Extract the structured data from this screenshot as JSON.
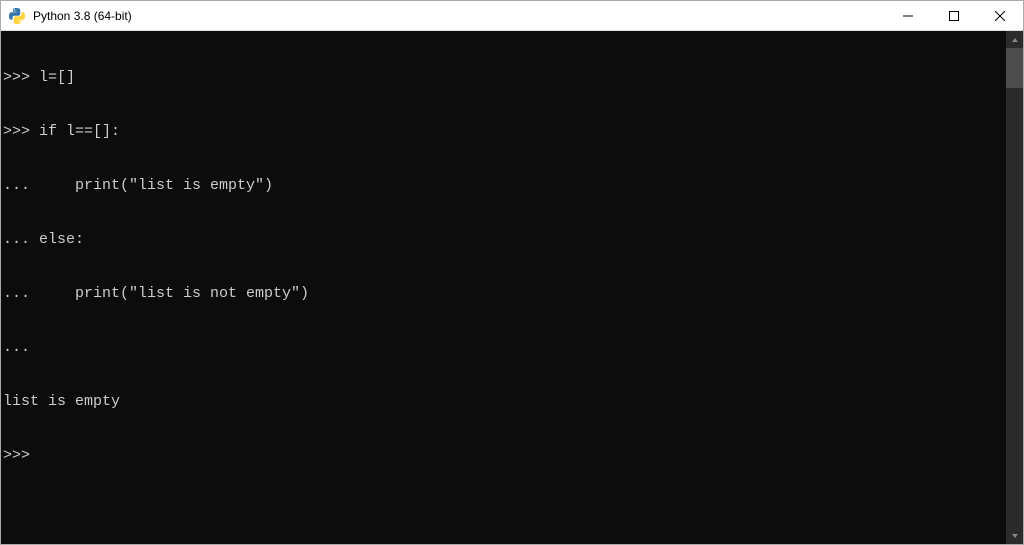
{
  "window": {
    "title": "Python 3.8 (64-bit)"
  },
  "console": {
    "lines": [
      ">>> l=[]",
      ">>> if l==[]:",
      "...     print(\"list is empty\")",
      "... else:",
      "...     print(\"list is not empty\")",
      "...",
      "list is empty",
      ">>>"
    ]
  }
}
